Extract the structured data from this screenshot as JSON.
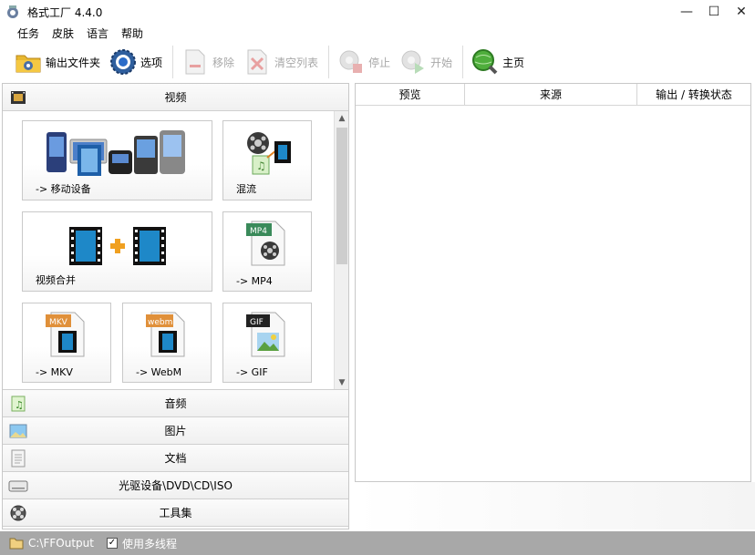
{
  "window": {
    "title": "格式工厂 4.4.0",
    "minimize": "—",
    "maximize": "☐",
    "close": "✕"
  },
  "menu": [
    "任务",
    "皮肤",
    "语言",
    "帮助"
  ],
  "toolbar": {
    "output_folder": "输出文件夹",
    "options": "选项",
    "remove": "移除",
    "clear_list": "清空列表",
    "stop": "停止",
    "start": "开始",
    "home": "主页"
  },
  "categories": {
    "video": "视频",
    "audio": "音频",
    "image": "图片",
    "document": "文档",
    "optical": "光驱设备\\DVD\\CD\\ISO",
    "tools": "工具集"
  },
  "video_tiles": [
    {
      "label": "-> 移动设备",
      "icon": "mobile-devices-icon"
    },
    {
      "label": "混流",
      "icon": "mux-icon"
    },
    {
      "label": "视频合并",
      "icon": "video-join-icon"
    },
    {
      "label": "-> MP4",
      "icon": "mp4-file-icon",
      "badge": "MP4"
    },
    {
      "label": "-> MKV",
      "icon": "mkv-file-icon",
      "badge": "MKV"
    },
    {
      "label": "-> WebM",
      "icon": "webm-file-icon",
      "badge": "webm"
    },
    {
      "label": "-> GIF",
      "icon": "gif-file-icon",
      "badge": "GIF"
    }
  ],
  "task_grid": {
    "columns": [
      "预览",
      "来源",
      "输出 / 转换状态"
    ]
  },
  "status": {
    "output_path": "C:\\FFOutput",
    "multithread_label": "使用多线程",
    "multithread_checked": true,
    "check_mark": "✓"
  },
  "colors": {
    "status_bar": "#a8a8a8",
    "disabled_text": "#a8a8a8",
    "film_blue": "#1e88c8"
  }
}
